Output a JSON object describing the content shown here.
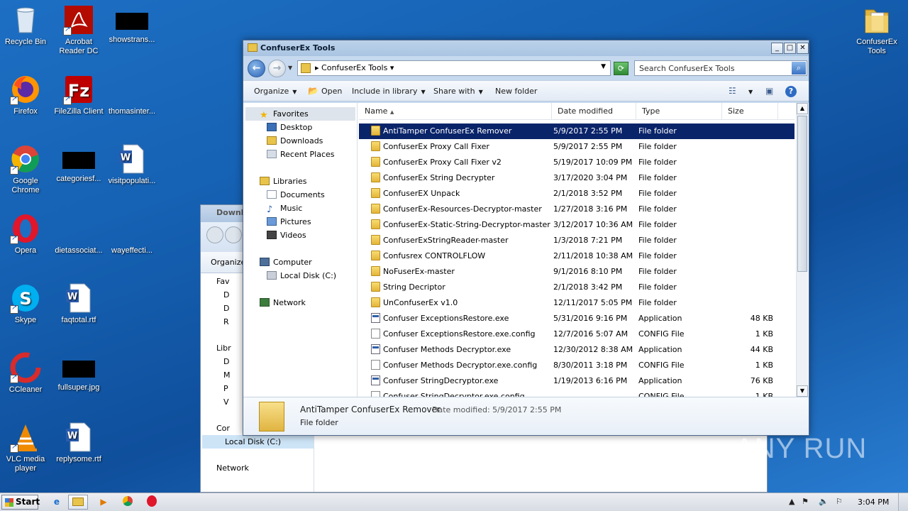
{
  "desktop": {
    "icons": [
      {
        "label": "Recycle Bin"
      },
      {
        "label": "Acrobat Reader DC"
      },
      {
        "label": "showstrans..."
      },
      {
        "label": "Firefox"
      },
      {
        "label": "FileZilla Client"
      },
      {
        "label": "thomasinter..."
      },
      {
        "label": "Google Chrome"
      },
      {
        "label": "categoriesf..."
      },
      {
        "label": "visitpopulati..."
      },
      {
        "label": "Opera"
      },
      {
        "label": "dietassociat..."
      },
      {
        "label": "wayeffecti..."
      },
      {
        "label": "Skype"
      },
      {
        "label": "faqtotal.rtf"
      },
      {
        "label": "CCleaner"
      },
      {
        "label": "fullsuper.jpg"
      },
      {
        "label": "VLC media player"
      },
      {
        "label": "replysome.rtf"
      },
      {
        "label": "ConfuserEx Tools"
      }
    ]
  },
  "back_window": {
    "title": "Downlo",
    "toolbar_organize": "Organize",
    "nav": [
      "Fav",
      "D",
      "D",
      "R",
      "Libr",
      "D",
      "M",
      "P",
      "V",
      "Cor",
      "Local Disk (C:)",
      "Network"
    ]
  },
  "window": {
    "title": "ConfuserEx Tools",
    "address": "ConfuserEx Tools",
    "search_placeholder": "Search ConfuserEx Tools",
    "toolbar": {
      "organize": "Organize",
      "open": "Open",
      "include_in_library": "Include in library",
      "share_with": "Share with",
      "new_folder": "New folder"
    },
    "nav": {
      "favorites": "Favorites",
      "desktop": "Desktop",
      "downloads": "Downloads",
      "recent_places": "Recent Places",
      "libraries": "Libraries",
      "documents": "Documents",
      "music": "Music",
      "pictures": "Pictures",
      "videos": "Videos",
      "computer": "Computer",
      "local_disk": "Local Disk (C:)",
      "network": "Network"
    },
    "columns": {
      "name": "Name",
      "date_modified": "Date modified",
      "type": "Type",
      "size": "Size"
    },
    "files": [
      {
        "name": "AntiTamper ConfuserEx Remover",
        "date": "5/9/2017 2:55 PM",
        "type": "File folder",
        "size": "",
        "kind": "folder"
      },
      {
        "name": "ConfuserEx Proxy Call Fixer",
        "date": "5/9/2017 2:55 PM",
        "type": "File folder",
        "size": "",
        "kind": "folder"
      },
      {
        "name": "ConfuserEx Proxy Call Fixer v2",
        "date": "5/19/2017 10:09 PM",
        "type": "File folder",
        "size": "",
        "kind": "folder"
      },
      {
        "name": "ConfuserEx String Decrypter",
        "date": "3/17/2020 3:04 PM",
        "type": "File folder",
        "size": "",
        "kind": "folder"
      },
      {
        "name": "ConfuserEX Unpack",
        "date": "2/1/2018 3:52 PM",
        "type": "File folder",
        "size": "",
        "kind": "folder"
      },
      {
        "name": "ConfuserEx-Resources-Decryptor-master",
        "date": "1/27/2018 3:16 PM",
        "type": "File folder",
        "size": "",
        "kind": "folder"
      },
      {
        "name": "ConfuserEx-Static-String-Decryptor-master",
        "date": "3/12/2017 10:36 AM",
        "type": "File folder",
        "size": "",
        "kind": "folder"
      },
      {
        "name": "ConfuserExStringReader-master",
        "date": "1/3/2018 7:21 PM",
        "type": "File folder",
        "size": "",
        "kind": "folder"
      },
      {
        "name": "Confusrex CONTROLFLOW",
        "date": "2/11/2018 10:38 AM",
        "type": "File folder",
        "size": "",
        "kind": "folder"
      },
      {
        "name": "NoFuserEx-master",
        "date": "9/1/2016 8:10 PM",
        "type": "File folder",
        "size": "",
        "kind": "folder"
      },
      {
        "name": "String Decriptor",
        "date": "2/1/2018 3:42 PM",
        "type": "File folder",
        "size": "",
        "kind": "folder"
      },
      {
        "name": "UnConfuserEx v1.0",
        "date": "12/11/2017 5:05 PM",
        "type": "File folder",
        "size": "",
        "kind": "folder"
      },
      {
        "name": "Confuser ExceptionsRestore.exe",
        "date": "5/31/2016 9:16 PM",
        "type": "Application",
        "size": "48 KB",
        "kind": "app"
      },
      {
        "name": "Confuser ExceptionsRestore.exe.config",
        "date": "12/7/2016 5:07 AM",
        "type": "CONFIG File",
        "size": "1 KB",
        "kind": "cfg"
      },
      {
        "name": "Confuser Methods Decryptor.exe",
        "date": "12/30/2012 8:38 AM",
        "type": "Application",
        "size": "44 KB",
        "kind": "app"
      },
      {
        "name": "Confuser Methods Decryptor.exe.config",
        "date": "8/30/2011 3:18 PM",
        "type": "CONFIG File",
        "size": "1 KB",
        "kind": "cfg"
      },
      {
        "name": "Confuser StringDecryptor.exe",
        "date": "1/19/2013 6:16 PM",
        "type": "Application",
        "size": "76 KB",
        "kind": "app"
      },
      {
        "name": "Confuser StringDecryptor.exe.config",
        "date": "",
        "type": "CONFIG File",
        "size": "1 KB",
        "kind": "cfg"
      }
    ],
    "details": {
      "name": "AntiTamper ConfuserEx Remover",
      "modified_label": "Date modified: 5/9/2017 2:55 PM",
      "type": "File folder"
    }
  },
  "taskbar": {
    "start": "Start",
    "clock": "3:04 PM"
  },
  "watermark": "ANY RUN"
}
